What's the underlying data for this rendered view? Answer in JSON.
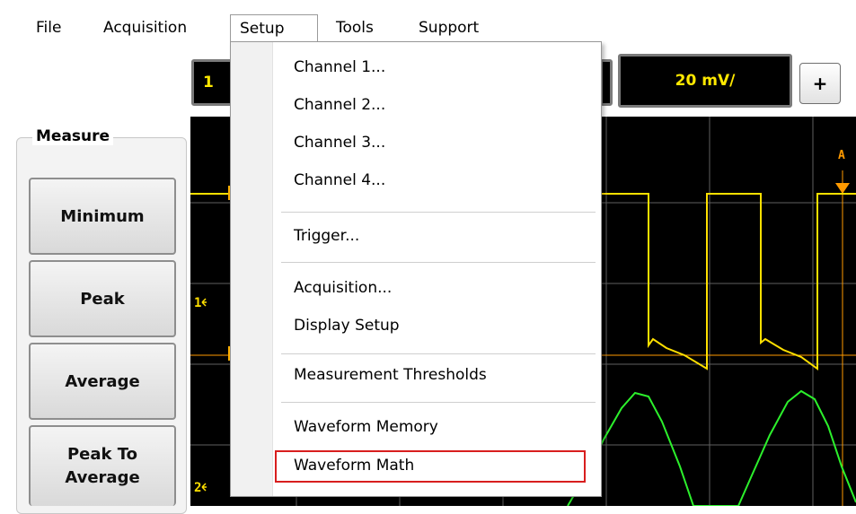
{
  "menubar": {
    "items": [
      "File",
      "Acquisition",
      "Setup",
      "Tools",
      "Support"
    ]
  },
  "toolbar": {
    "channel_box_label": "1",
    "scale_label": "20 mV/",
    "plus_label": "+"
  },
  "measure": {
    "title": "Measure",
    "buttons": [
      "Minimum",
      "Peak",
      "Average",
      "Peak To Average"
    ]
  },
  "scope": {
    "marker_1": "1",
    "marker_2": "2",
    "top_label": "A"
  },
  "setup_menu": {
    "items": [
      "Channel 1...",
      "Channel 2...",
      "Channel 3...",
      "Channel 4...",
      "Trigger...",
      "Acquisition...",
      "Display Setup",
      "Measurement Thresholds",
      "Waveform Memory",
      "Waveform Math"
    ],
    "highlighted_item": "Waveform Math"
  },
  "colors": {
    "channel1": "#ffe000",
    "channel2": "#2cf02c",
    "trigger_line": "#ff9a00",
    "grid": "#6a6a6a",
    "highlight_border": "#d81e1e"
  }
}
